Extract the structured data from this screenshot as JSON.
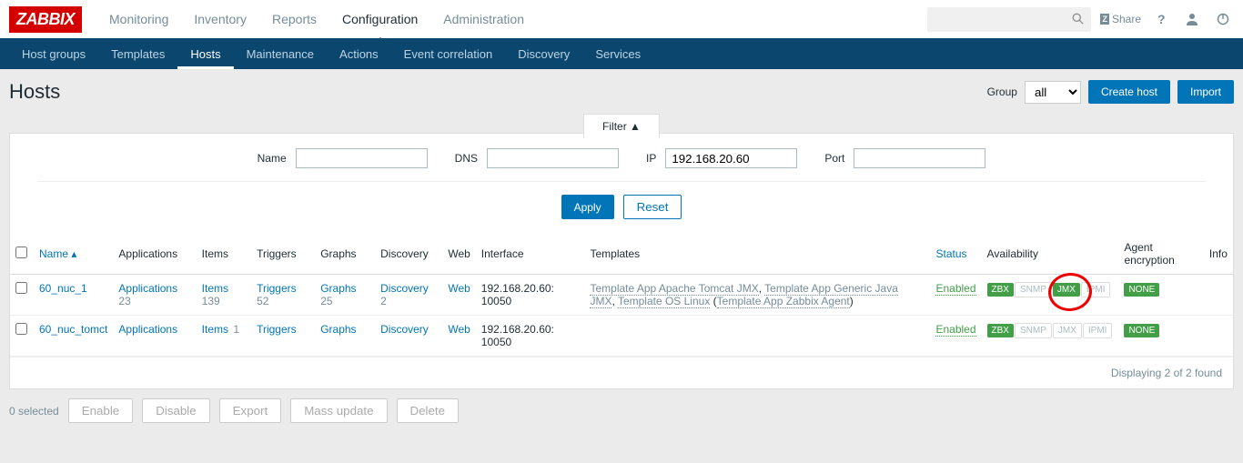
{
  "logo_text": "ZABBIX",
  "topnav": {
    "monitoring": "Monitoring",
    "inventory": "Inventory",
    "reports": "Reports",
    "configuration": "Configuration",
    "administration": "Administration"
  },
  "share_label": "Share",
  "subnav": {
    "hostgroups": "Host groups",
    "templates": "Templates",
    "hosts": "Hosts",
    "maintenance": "Maintenance",
    "actions": "Actions",
    "event_correlation": "Event correlation",
    "discovery": "Discovery",
    "services": "Services"
  },
  "page": {
    "title": "Hosts",
    "group_label": "Group",
    "group_value": "all",
    "create_btn": "Create host",
    "import_btn": "Import"
  },
  "filter": {
    "tab_label": "Filter ▲",
    "name_label": "Name",
    "dns_label": "DNS",
    "ip_label": "IP",
    "ip_value": "192.168.20.60",
    "port_label": "Port",
    "apply": "Apply",
    "reset": "Reset"
  },
  "table": {
    "headers": {
      "name": "Name",
      "applications": "Applications",
      "items": "Items",
      "triggers": "Triggers",
      "graphs": "Graphs",
      "discovery": "Discovery",
      "web": "Web",
      "interface": "Interface",
      "templates": "Templates",
      "status": "Status",
      "availability": "Availability",
      "agent_encryption": "Agent encryption",
      "info": "Info"
    },
    "rows": [
      {
        "name": "60_nuc_1",
        "apps_label": "Applications",
        "apps_cnt": "23",
        "items_label": "Items",
        "items_cnt": "139",
        "triggers_label": "Triggers",
        "triggers_cnt": "52",
        "graphs_label": "Graphs",
        "graphs_cnt": "25",
        "discovery_label": "Discovery",
        "discovery_cnt": "2",
        "web_label": "Web",
        "interface": "192.168.20.60: 10050",
        "templates_text": "Template App Apache Tomcat JMX, Template App Generic Java JMX, Template OS Linux (Template App Zabbix Agent)",
        "status": "Enabled",
        "zbx": "ZBX",
        "snmp": "SNMP",
        "jmx": "JMX",
        "ipmi": "IPMI",
        "encryption": "NONE",
        "jmx_active": true
      },
      {
        "name": "60_nuc_tomct",
        "apps_label": "Applications",
        "apps_cnt": "",
        "items_label": "Items",
        "items_cnt": "1",
        "triggers_label": "Triggers",
        "triggers_cnt": "",
        "graphs_label": "Graphs",
        "graphs_cnt": "",
        "discovery_label": "Discovery",
        "discovery_cnt": "",
        "web_label": "Web",
        "interface": "192.168.20.60: 10050",
        "templates_text": "",
        "status": "Enabled",
        "zbx": "ZBX",
        "snmp": "SNMP",
        "jmx": "JMX",
        "ipmi": "IPMI",
        "encryption": "NONE",
        "jmx_active": false
      }
    ],
    "footer": "Displaying 2 of 2 found"
  },
  "bulk": {
    "selected": "0 selected",
    "enable": "Enable",
    "disable": "Disable",
    "export": "Export",
    "mass_update": "Mass update",
    "delete": "Delete"
  }
}
